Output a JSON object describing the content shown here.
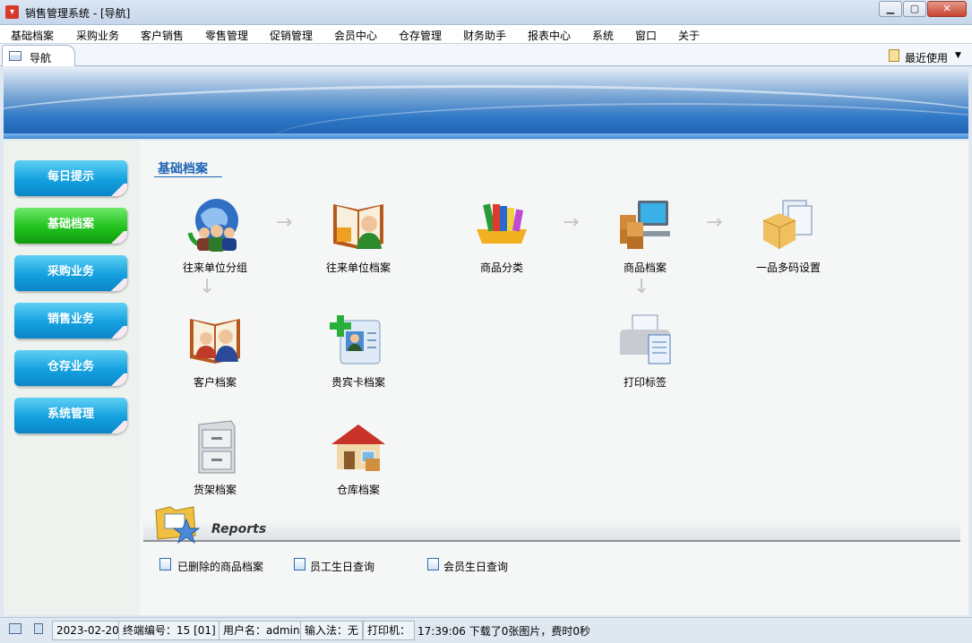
{
  "window": {
    "title": "销售管理系统 - [导航]",
    "app_icon": "cart-icon",
    "minimize": "minimize-icon",
    "maximize": "maximize-icon",
    "close": "close-icon"
  },
  "menu": [
    "基础档案",
    "采购业务",
    "客户销售",
    "零售管理",
    "促销管理",
    "会员中心",
    "仓存管理",
    "财务助手",
    "报表中心",
    "系统",
    "窗口",
    "关于"
  ],
  "tabs": {
    "active": "导航",
    "recent_label": "最近使用"
  },
  "nav": {
    "buttons": [
      "每日提示",
      "基础档案",
      "采购业务",
      "销售业务",
      "仓存业务",
      "系统管理"
    ],
    "active_index": 1,
    "colors": {
      "normal": "#13a0df",
      "active": "#21c21d"
    }
  },
  "section": {
    "title": "基础档案",
    "tiles": [
      {
        "label": "往来单位分组",
        "icon": "globe-people-icon"
      },
      {
        "label": "往来单位档案",
        "icon": "book-people-icon"
      },
      {
        "label": "商品分类",
        "icon": "books-shelf-icon"
      },
      {
        "label": "商品档案",
        "icon": "computer-boxes-icon"
      },
      {
        "label": "一品多码设置",
        "icon": "box-documents-icon"
      },
      {
        "label": "客户档案",
        "icon": "book-customer-icon"
      },
      {
        "label": "贵宾卡档案",
        "icon": "vip-card-icon"
      },
      {
        "label": "打印标签",
        "icon": "printer-icon"
      },
      {
        "label": "货架档案",
        "icon": "cabinet-icon"
      },
      {
        "label": "仓库档案",
        "icon": "warehouse-icon"
      }
    ]
  },
  "reports": {
    "title": "Reports",
    "links": [
      "已删除的商品档案",
      "员工生日查询",
      "会员生日查询"
    ]
  },
  "status": {
    "date": "2023-02-20",
    "terminal": "终端编号：15 [01]",
    "user": "用户名：admin",
    "ime": "输入法：无",
    "printer": "打印机：",
    "message": "17:39:06 下载了0张图片，费时0秒"
  }
}
